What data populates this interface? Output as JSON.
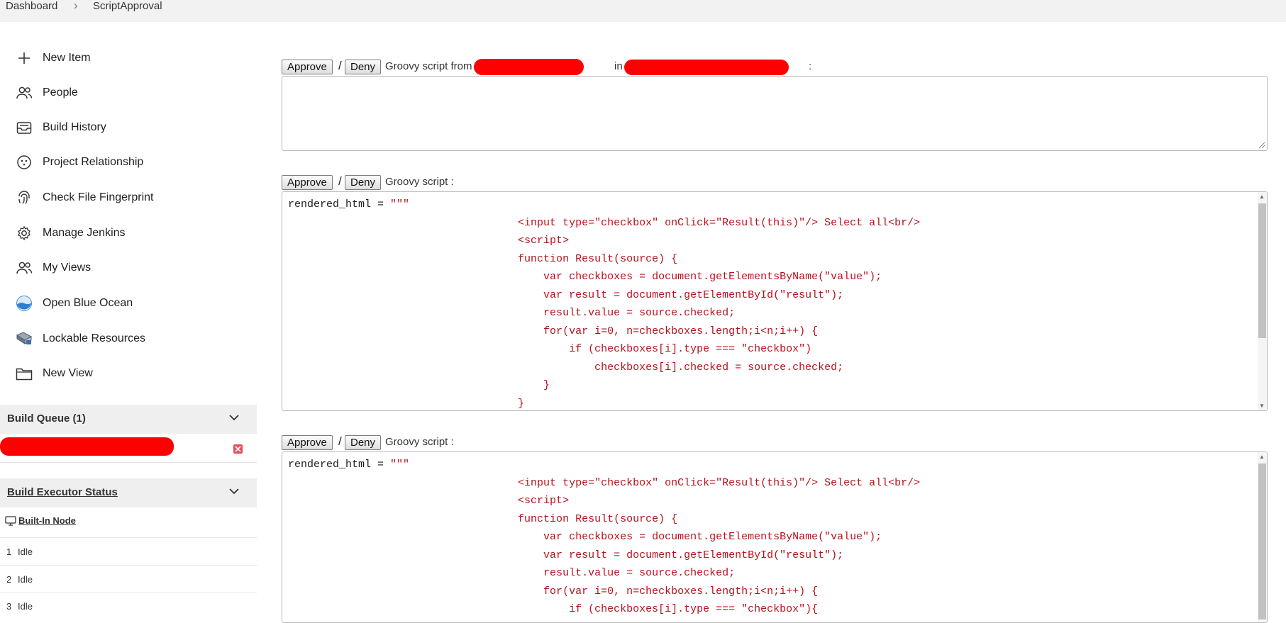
{
  "breadcrumb": {
    "home": "Dashboard",
    "current": "ScriptApproval"
  },
  "sidebar": {
    "items": [
      {
        "label": "New Item",
        "icon": "plus-icon"
      },
      {
        "label": "People",
        "icon": "people-icon"
      },
      {
        "label": "Build History",
        "icon": "inbox-icon"
      },
      {
        "label": "Project Relationship",
        "icon": "relationship-icon"
      },
      {
        "label": "Check File Fingerprint",
        "icon": "fingerprint-icon"
      },
      {
        "label": "Manage Jenkins",
        "icon": "gear-icon"
      },
      {
        "label": "My Views",
        "icon": "people-icon"
      },
      {
        "label": "Open Blue Ocean",
        "icon": "blue-ocean-icon"
      },
      {
        "label": "Lockable Resources",
        "icon": "lock-resource-icon"
      },
      {
        "label": "New View",
        "icon": "folder-icon"
      }
    ]
  },
  "build_queue": {
    "title": "Build Queue (1)"
  },
  "executor": {
    "title": "Build Executor Status",
    "node": "Built-In Node",
    "rows": [
      {
        "num": "1",
        "status": "Idle"
      },
      {
        "num": "2",
        "status": "Idle"
      },
      {
        "num": "3",
        "status": "Idle"
      }
    ]
  },
  "approvals": [
    {
      "approve": "Approve",
      "sep": "/",
      "deny": "Deny",
      "text": "Groovy script from",
      "in_text": "in",
      "colon": ":"
    },
    {
      "approve": "Approve",
      "sep": "/",
      "deny": "Deny",
      "text": "Groovy script :"
    },
    {
      "approve": "Approve",
      "sep": "/",
      "deny": "Deny",
      "text": "Groovy script :"
    }
  ],
  "code": {
    "lines": [
      "rendered_html = \"\"\"",
      "                                    <input type=\"checkbox\" onClick=\"Result(this)\"/> Select all<br/>",
      "                                    <script>",
      "                                    function Result(source) {",
      "                                        var checkboxes = document.getElementsByName(\"value\");",
      "                                        var result = document.getElementById(\"result\");",
      "                                        result.value = source.checked;",
      "                                        for(var i=0, n=checkboxes.length;i<n;i++) {",
      "                                            if (checkboxes[i].type === \"checkbox\")",
      "                                                checkboxes[i].checked = source.checked;",
      "                                        }",
      "                                    }"
    ],
    "lines3": [
      "rendered_html = \"\"\"",
      "                                    <input type=\"checkbox\" onClick=\"Result(this)\"/> Select all<br/>",
      "                                    <script>",
      "                                    function Result(source) {",
      "                                        var checkboxes = document.getElementsByName(\"value\");",
      "                                        var result = document.getElementById(\"result\");",
      "                                        result.value = source.checked;",
      "                                        for(var i=0, n=checkboxes.length;i<n;i++) {",
      "                                            if (checkboxes[i].type === \"checkbox\"){"
    ]
  },
  "colors": {
    "code_string": "#b5121b",
    "redaction": "#ff0000"
  }
}
